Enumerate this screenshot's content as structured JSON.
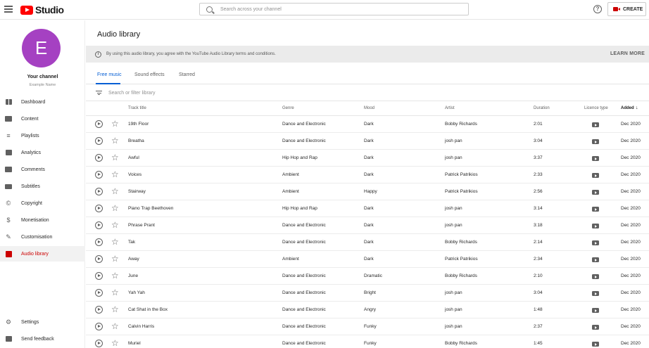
{
  "header": {
    "logo_text": "Studio",
    "search_placeholder": "Search across your channel",
    "help_glyph": "?",
    "create_label": "CREATE"
  },
  "channel": {
    "initial": "E",
    "name": "Your channel",
    "subtitle": "Example Name",
    "avatar_color": "#a541c2"
  },
  "nav": {
    "items": [
      {
        "label": "Dashboard",
        "icon": "dashboard-icon"
      },
      {
        "label": "Content",
        "icon": "content-icon"
      },
      {
        "label": "Playlists",
        "icon": "playlists-icon"
      },
      {
        "label": "Analytics",
        "icon": "analytics-icon"
      },
      {
        "label": "Comments",
        "icon": "comments-icon"
      },
      {
        "label": "Subtitles",
        "icon": "subtitles-icon"
      },
      {
        "label": "Copyright",
        "icon": "copyright-icon"
      },
      {
        "label": "Monetisation",
        "icon": "monetisation-icon"
      },
      {
        "label": "Customisation",
        "icon": "customisation-icon"
      },
      {
        "label": "Audio library",
        "icon": "audio-library-icon",
        "active": true
      }
    ],
    "bottom": [
      {
        "label": "Settings",
        "icon": "settings-icon"
      },
      {
        "label": "Send feedback",
        "icon": "feedback-icon"
      }
    ]
  },
  "main": {
    "title": "Audio library",
    "notice": "By using this audio library, you agree with the YouTube Audio Library terms and conditions.",
    "learn_more": "LEARN MORE",
    "tabs": [
      "Free music",
      "Sound effects",
      "Starred"
    ],
    "filter_placeholder": "Search or filter library",
    "columns": {
      "title": "Track title",
      "genre": "Genre",
      "mood": "Mood",
      "artist": "Artist",
      "duration": "Duration",
      "licence": "Licence type",
      "added": "Added",
      "sort_glyph": "↓"
    },
    "tracks": [
      {
        "title": "19th Floor",
        "genre": "Dance and Electronic",
        "mood": "Dark",
        "artist": "Bobby Richards",
        "duration": "2:01",
        "added": "Dec 2020"
      },
      {
        "title": "Breatha",
        "genre": "Dance and Electronic",
        "mood": "Dark",
        "artist": "josh pan",
        "duration": "3:04",
        "added": "Dec 2020"
      },
      {
        "title": "Awful",
        "genre": "Hip Hop and Rap",
        "mood": "Dark",
        "artist": "josh pan",
        "duration": "3:37",
        "added": "Dec 2020"
      },
      {
        "title": "Voices",
        "genre": "Ambient",
        "mood": "Dark",
        "artist": "Patrick Patrikios",
        "duration": "2:33",
        "added": "Dec 2020"
      },
      {
        "title": "Stairway",
        "genre": "Ambient",
        "mood": "Happy",
        "artist": "Patrick Patrikios",
        "duration": "2:56",
        "added": "Dec 2020"
      },
      {
        "title": "Piano Trap Beethoven",
        "genre": "Hip Hop and Rap",
        "mood": "Dark",
        "artist": "josh pan",
        "duration": "3:14",
        "added": "Dec 2020"
      },
      {
        "title": "Phrase Prant",
        "genre": "Dance and Electronic",
        "mood": "Dark",
        "artist": "josh pan",
        "duration": "3:18",
        "added": "Dec 2020"
      },
      {
        "title": "Tak",
        "genre": "Dance and Electronic",
        "mood": "Dark",
        "artist": "Bobby Richards",
        "duration": "2:14",
        "added": "Dec 2020"
      },
      {
        "title": "Away",
        "genre": "Ambient",
        "mood": "Dark",
        "artist": "Patrick Patrikios",
        "duration": "2:34",
        "added": "Dec 2020"
      },
      {
        "title": "June",
        "genre": "Dance and Electronic",
        "mood": "Dramatic",
        "artist": "Bobby Richards",
        "duration": "2:10",
        "added": "Dec 2020"
      },
      {
        "title": "Yah Yah",
        "genre": "Dance and Electronic",
        "mood": "Bright",
        "artist": "josh pan",
        "duration": "3:04",
        "added": "Dec 2020"
      },
      {
        "title": "Cat Shat in the Box",
        "genre": "Dance and Electronic",
        "mood": "Angry",
        "artist": "josh pan",
        "duration": "1:48",
        "added": "Dec 2020"
      },
      {
        "title": "Calvin Harris",
        "genre": "Dance and Electronic",
        "mood": "Funky",
        "artist": "josh pan",
        "duration": "2:37",
        "added": "Dec 2020"
      },
      {
        "title": "Muriel",
        "genre": "Dance and Electronic",
        "mood": "Funky",
        "artist": "Bobby Richards",
        "duration": "1:45",
        "added": "Dec 2020"
      }
    ]
  },
  "colors": {
    "accent": "#065fd4",
    "brand_red": "#ff0000",
    "active_nav": "#cc0000"
  }
}
